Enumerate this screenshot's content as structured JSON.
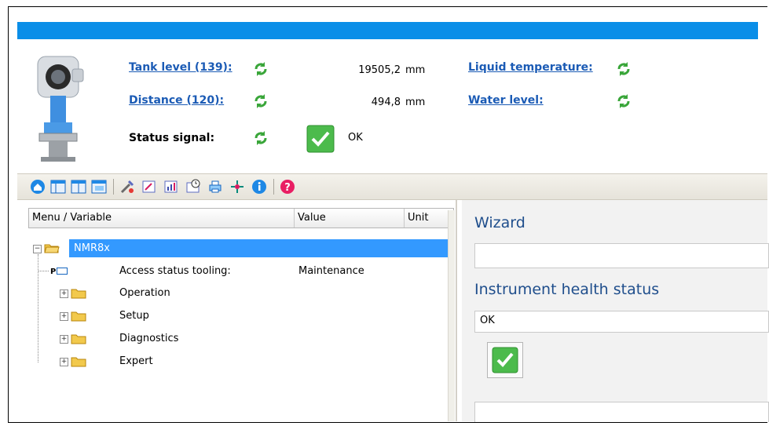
{
  "header": {
    "tank_level_label": "Tank level (139):",
    "tank_level_value": "19505,2",
    "tank_level_unit": "mm",
    "distance_label": "Distance (120):",
    "distance_value": "494,8",
    "distance_unit": "mm",
    "status_signal_label": "Status signal:",
    "status_signal_value": "OK",
    "liquid_temperature_label": "Liquid temperature:",
    "water_level_label": "Water level:"
  },
  "toolbar": {
    "icons": [
      "home-icon",
      "layout-1-icon",
      "layout-2-icon",
      "layout-3-icon",
      "tools-icon",
      "edit-icon",
      "chart-icon",
      "clock-icon",
      "print-icon",
      "network-icon",
      "info-icon",
      "help-icon"
    ]
  },
  "tree": {
    "columns": [
      "Menu / Variable",
      "Value",
      "Unit"
    ],
    "root": "NMR8x",
    "items": [
      {
        "label": "Access status tooling:",
        "value": "Maintenance"
      },
      {
        "label": "Operation"
      },
      {
        "label": "Setup"
      },
      {
        "label": "Diagnostics"
      },
      {
        "label": "Expert"
      }
    ]
  },
  "right_panel": {
    "wizard_title": "Wizard",
    "health_title": "Instrument health status",
    "health_value": "OK"
  },
  "colors": {
    "accent_bar": "#0a8ee8",
    "link": "#1b5bb5",
    "selection": "#3399ff",
    "panel_title": "#1f4e8c"
  }
}
